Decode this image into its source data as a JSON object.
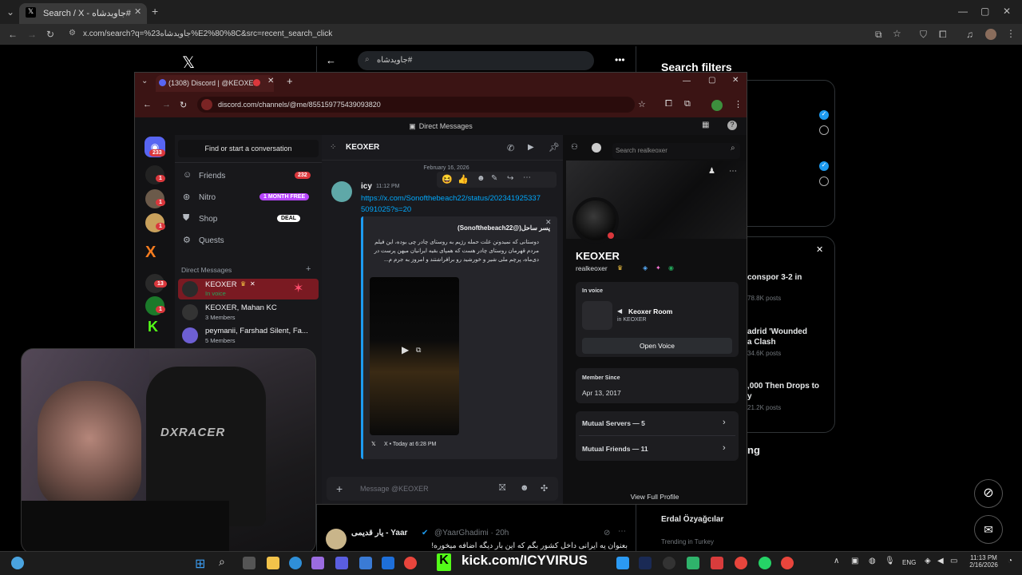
{
  "outer_browser": {
    "tab_title": "Search / X - جاویدشاه#",
    "url": "x.com/search?q=%23جاویدشاه%E2%80%8C&src=recent_search_click"
  },
  "x_page": {
    "search_query": "جاویدشاه#",
    "filters_title": "Search filters",
    "trends": [
      {
        "title": "conspor 3-2 in",
        "sub": "78.8K posts"
      },
      {
        "title": "adrid 'Wounded",
        "title2": "a Clash",
        "sub": "34.6K posts"
      },
      {
        "title": ",000 Then Drops to",
        "title2": "y",
        "sub": "21.2K posts"
      }
    ],
    "follow_suffix": "ng",
    "who_name": "Erdal Özyağcılar",
    "trending_in": "Trending in Turkey",
    "tweet": {
      "author": "یار قدیمی - Yaar",
      "handle": "@YaarGhadimi · 20h",
      "text": "بعنوان یه ایرانی داخل کشور بگم که این بار دیگه اضافه میخوره!"
    }
  },
  "discord": {
    "tab_title": "(1308) Discord | @KEOXER",
    "url": "discord.com/channels/@me/855159775439093820",
    "topbar_title": "Direct Messages",
    "guild_badges": [
      "233",
      "1",
      "1",
      "1",
      "13",
      "1"
    ],
    "find_placeholder": "Find or start a conversation",
    "nav": [
      {
        "label": "Friends",
        "badge": "232"
      },
      {
        "label": "Nitro",
        "badge": "1 MONTH FREE"
      },
      {
        "label": "Shop",
        "badge": "DEAL"
      },
      {
        "label": "Quests",
        "badge": ""
      }
    ],
    "dm_header": "Direct Messages",
    "dms": [
      {
        "name": "KEOXER",
        "sub": "In voice"
      },
      {
        "name": "KEOXER, Mahan KC",
        "sub": "3 Members"
      },
      {
        "name": "peymanii, Farshad Silent, Fa...",
        "sub": "5 Members"
      }
    ],
    "chat": {
      "channel": "KEOXER",
      "search_placeholder": "Search realkeoxer",
      "date_divider": "February 16, 2026",
      "author": "icy",
      "time": "11:12 PM",
      "link": "https://x.com/Sonofthebeach22/status/2023419253375091025?s=20",
      "embed_author": "پسر ساحل(@Sonofthebeach22)",
      "embed_text": "دوستانی که نمیدونن علت حمله رژیم به روستای چادر چی بوده، این فیلم مردم قهرمان روستای چادر هست که همپای بقیه ایرانیان میهن پرست در دی‌ماه، پرچم ملی شیر و خورشید رو برافراشتند و امروز به جرم م...",
      "embed_footer": "X • Today at 6:28 PM",
      "input_placeholder": "Message @KEOXER"
    },
    "profile": {
      "name": "KEOXER",
      "username": "realkeoxer",
      "in_voice_label": "In voice",
      "room_name": "Keoxer Room",
      "room_sub": "in KEOXER",
      "open_voice": "Open Voice",
      "member_since_label": "Member Since",
      "member_since": "Apr 13, 2017",
      "mutual_servers": "Mutual Servers — 5",
      "mutual_friends": "Mutual Friends — 11",
      "view_full": "View Full Profile"
    }
  },
  "stream_overlay": {
    "kick_url": "kick.com/ICYVIRUS"
  },
  "taskbar": {
    "lang": "ENG",
    "time": "11:13 PM",
    "date": "2/16/2026"
  },
  "colors": {
    "discord_blurple": "#5865f2",
    "x_blue": "#1d9bf0",
    "kick_green": "#53fc18",
    "discord_red": "#da373c",
    "nitro_purple": "#b845ff"
  }
}
